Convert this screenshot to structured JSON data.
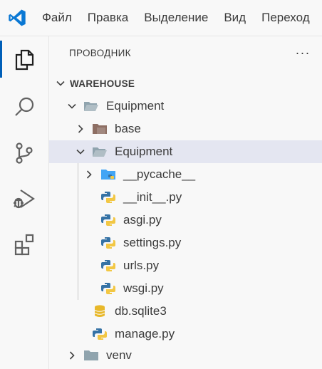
{
  "menu": [
    "Файл",
    "Правка",
    "Выделение",
    "Вид",
    "Переход"
  ],
  "explorer": {
    "title": "ПРОВОДНИК",
    "more_label": "···",
    "section": "WAREHOUSE",
    "tree": [
      {
        "label": "Equipment",
        "type": "folder",
        "expanded": true
      },
      {
        "label": "base",
        "type": "folder-special",
        "expanded": false
      },
      {
        "label": "Equipment",
        "type": "folder",
        "expanded": true,
        "selected": true
      },
      {
        "label": "__pycache__",
        "type": "folder-pycache",
        "expanded": false
      },
      {
        "label": "__init__.py",
        "type": "python-file"
      },
      {
        "label": "asgi.py",
        "type": "python-file"
      },
      {
        "label": "settings.py",
        "type": "python-file"
      },
      {
        "label": "urls.py",
        "type": "python-file"
      },
      {
        "label": "wsgi.py",
        "type": "python-file"
      },
      {
        "label": "db.sqlite3",
        "type": "database-file"
      },
      {
        "label": "manage.py",
        "type": "python-file"
      },
      {
        "label": "venv",
        "type": "folder",
        "expanded": false
      }
    ]
  },
  "activity": [
    "explorer-icon",
    "search-icon",
    "source-control-icon",
    "run-debug-icon",
    "extensions-icon"
  ],
  "colors": {
    "accent": "#005fb8",
    "selection": "#e4e6f1",
    "python_blue": "#3572a5",
    "python_yellow": "#f2c744",
    "db_yellow": "#e8b82a"
  }
}
